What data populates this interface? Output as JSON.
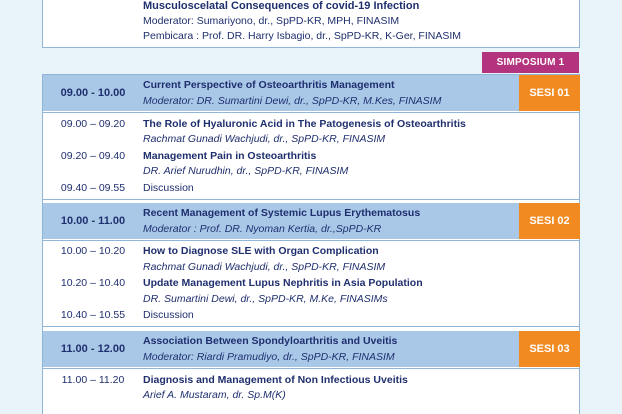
{
  "top": {
    "title": "Musculoscelatal Consequences of covid-19 Infection",
    "moderator": "Moderator:  Sumariyono, dr., SpPD-KR, MPH, FINASIM",
    "pembicara": "Pembicara : Prof. DR. Harry Isbagio, dr., SpPD-KR, K-Ger, FINASIM"
  },
  "simposium_label": "SIMPOSIUM 1",
  "sessions": [
    {
      "time": "09.00 - 10.00",
      "title": "Current Perspective of Osteoarthritis Management",
      "moderator": "Moderator: DR. Sumartini Dewi, dr., SpPD-KR, M.Kes, FINASIM",
      "badge": "SESI 01",
      "talks": [
        {
          "time": "09.00 – 09.20",
          "title": "The Role of Hyaluronic Acid in The Patogenesis of Osteoarthritis",
          "speaker": "Rachmat Gunadi Wachjudi, dr., SpPD-KR, FINASIM"
        },
        {
          "time": "09.20 – 09.40",
          "title": "Management Pain in Osteoarthritis",
          "speaker": "DR. Arief Nurudhin, dr., SpPD-KR, FINASIM"
        }
      ],
      "discussion_time": "09.40 – 09.55",
      "discussion": "Discussion"
    },
    {
      "time": "10.00 - 11.00",
      "title": "Recent Management of Systemic Lupus Erythematosus",
      "moderator": "Moderator : Prof. DR. Nyoman Kertia, dr.,SpPD-KR",
      "badge": "SESI 02",
      "talks": [
        {
          "time": "10.00 – 10.20",
          "title": "How to Diagnose SLE with Organ Complication",
          "speaker": "Rachmat Gunadi Wachjudi, dr., SpPD-KR, FINASIM"
        },
        {
          "time": "10.20 – 10.40",
          "title": "Update Management Lupus Nephritis in Asia Population",
          "speaker": "DR. Sumartini Dewi, dr., SpPD-KR, M.Ke, FINASIMs"
        }
      ],
      "discussion_time": "10.40 – 10.55",
      "discussion": "Discussion"
    },
    {
      "time": "11.00 - 12.00",
      "title": "Association Between Spondyloarthritis and Uveitis",
      "moderator": "Moderator: Riardi Pramudiyo, dr., SpPD-KR, FINASIM",
      "badge": "SESI 03",
      "talks": [
        {
          "time": "11.00 – 11.20",
          "title": "Diagnosis and Management of Non Infectious Uveitis",
          "speaker": "Arief A. Mustaram, dr. Sp.M(K)"
        }
      ]
    }
  ]
}
